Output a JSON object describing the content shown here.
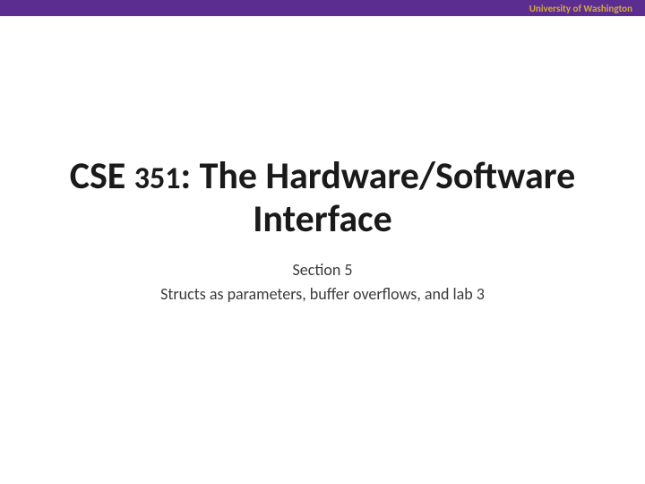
{
  "header": {
    "institution": "University of Washington"
  },
  "title": {
    "course_prefix": "CSE ",
    "course_number": "351",
    "suffix": ": The Hardware/Software Interface"
  },
  "subtitle": {
    "line1": "Section 5",
    "line2": "Structs as parameters, buffer overflows, and lab 3"
  }
}
